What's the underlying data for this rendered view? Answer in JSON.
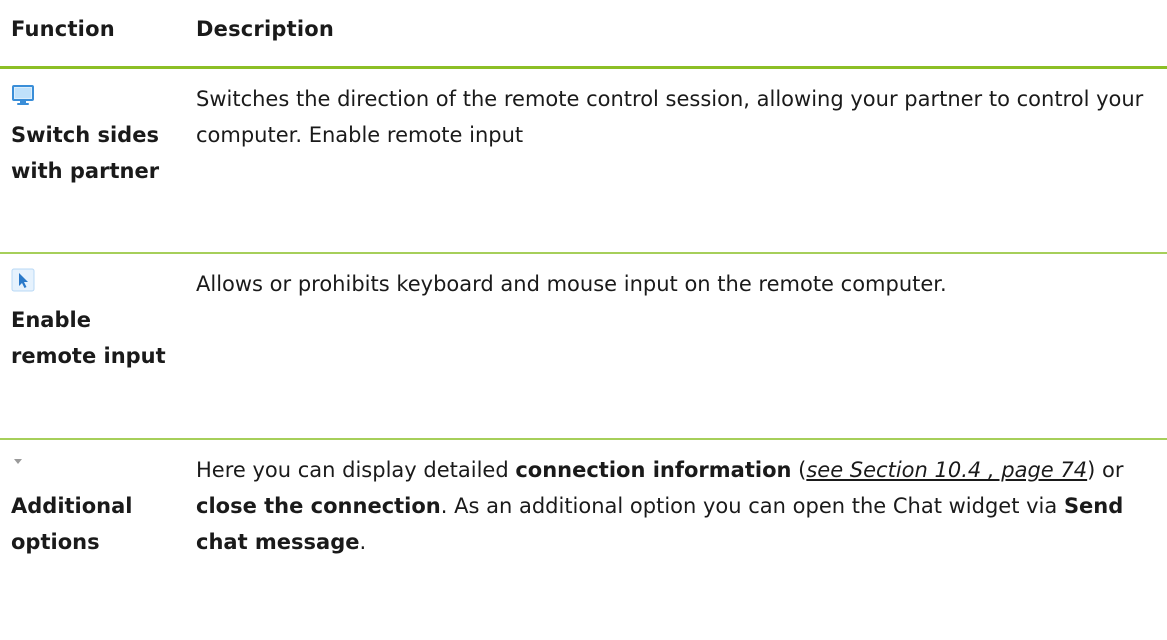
{
  "header": {
    "function_label": "Function",
    "description_label": "Description"
  },
  "rows": [
    {
      "icon": "monitor-icon",
      "function": "Switch sides with partner",
      "description": "Switches the direction of the remote control session, allowing your partner to control your computer. Enable remote input"
    },
    {
      "icon": "cursor-arrow-icon",
      "function": "Enable remote input",
      "description": "Allows or prohibits keyboard and mouse input on the remote computer."
    },
    {
      "icon": "dropdown-triangle-icon",
      "function": "Additional options",
      "description_parts": {
        "p1": "Here you can display detailed ",
        "b1": "connection information",
        "p2": " (",
        "link": "see Section 10.4 , page 74",
        "p3": ") or ",
        "b2": "close the connection",
        "p4": ". As an additional option you can open the Chat widget via ",
        "b3": "Send chat message",
        "p5": "."
      }
    }
  ],
  "colors": {
    "rule_accent": "#8cbf26",
    "icon_blue": "#3a8ed8",
    "icon_fill": "#dbeefc"
  }
}
